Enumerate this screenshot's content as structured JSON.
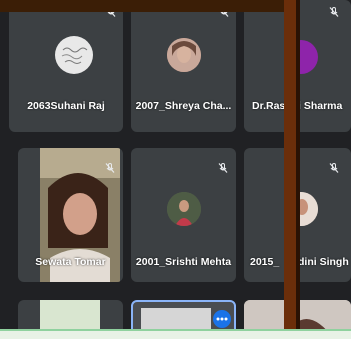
{
  "participants": [
    {
      "name": "2063Suhani Raj"
    },
    {
      "name": "2007_Shreya Cha..."
    },
    {
      "name": "Dr.Ras"
    },
    {
      "name": "i Sharma"
    },
    {
      "name": "Sewata Tomar"
    },
    {
      "name": "2001_Srishti Mehta"
    },
    {
      "name": "2015_"
    },
    {
      "name": "dini Singh"
    }
  ],
  "icons": {
    "muted": "mic-off-icon",
    "more": "more-options-icon"
  },
  "colors": {
    "tile_bg": "#3c4043",
    "page_bg": "#202124",
    "purple_avatar": "#8e24aa",
    "active_border": "#8ab4f8",
    "more_button": "#1a73e8"
  }
}
